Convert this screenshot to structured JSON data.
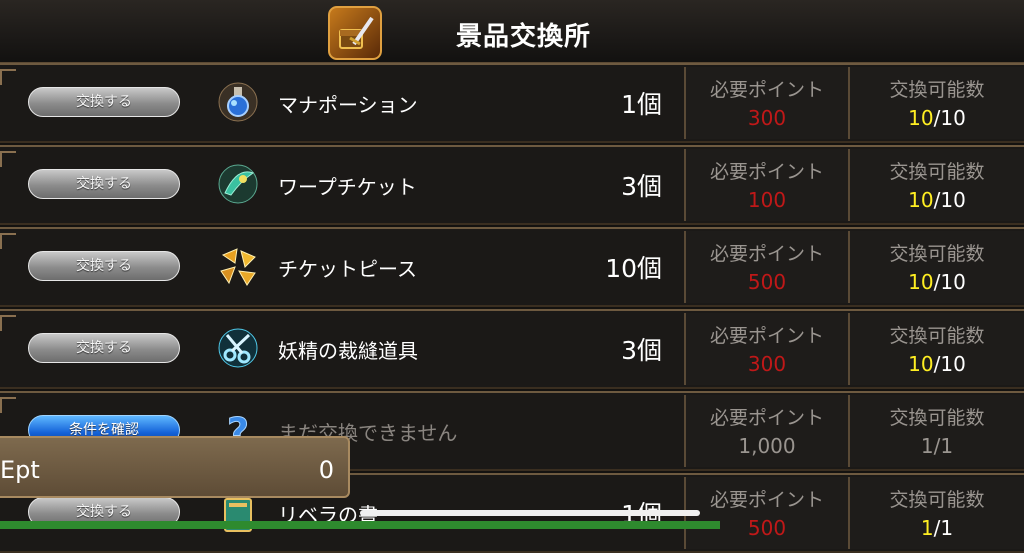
{
  "header": {
    "title": "景品交換所",
    "icon": "treasure-shop-icon"
  },
  "columns": {
    "points_label": "必要ポイント",
    "count_label": "交換可能数"
  },
  "rows": [
    {
      "button": "交換する",
      "button_color": "gray",
      "icon": "potion-icon",
      "name": "マナポーション",
      "qty": "1個",
      "points": "300",
      "count_current": "10",
      "count_total": "/10"
    },
    {
      "button": "交換する",
      "button_color": "gray",
      "icon": "warp-ticket-icon",
      "name": "ワープチケット",
      "qty": "3個",
      "points": "100",
      "count_current": "10",
      "count_total": "/10"
    },
    {
      "button": "交換する",
      "button_color": "gray",
      "icon": "ticket-piece-icon",
      "name": "チケットピース",
      "qty": "10個",
      "points": "500",
      "count_current": "10",
      "count_total": "/10"
    },
    {
      "button": "交換する",
      "button_color": "gray",
      "icon": "sewing-tools-icon",
      "name": "妖精の裁縫道具",
      "qty": "3個",
      "points": "300",
      "count_current": "10",
      "count_total": "/10"
    },
    {
      "button": "条件を確認",
      "button_color": "blue",
      "icon": "question-mark-icon",
      "name": "まだ交換できません",
      "qty": "",
      "points": "1,000",
      "count_current": "1",
      "count_total": "/1"
    },
    {
      "button": "交換する",
      "button_color": "gray",
      "icon": "book-icon",
      "name": "リベラの書",
      "qty": "1個",
      "points": "500",
      "count_current": "1",
      "count_total": "/1"
    }
  ],
  "ept": {
    "label": "Ept",
    "value": "0"
  },
  "colors": {
    "points_red": "#c01818",
    "count_yellow": "#ffee22",
    "frame_brown": "#6e5a40"
  }
}
